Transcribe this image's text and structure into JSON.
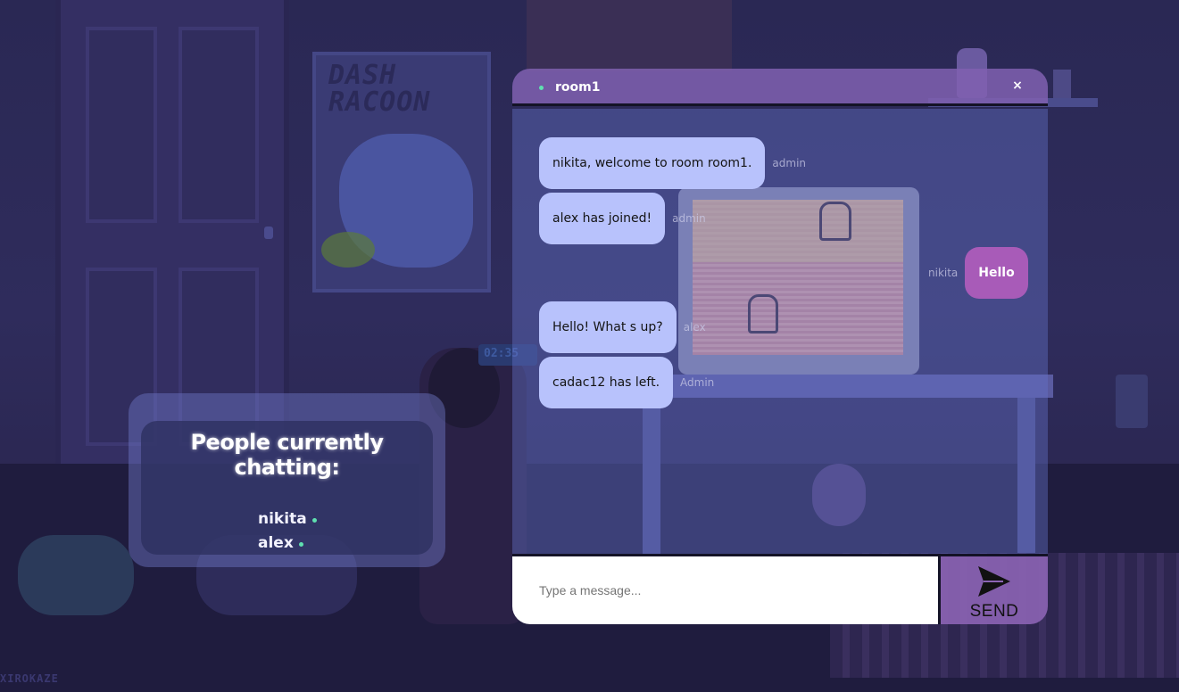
{
  "background": {
    "poster_text": "DASH\nRACOON",
    "clock_text": "02:35",
    "signature": "XIROKAZE"
  },
  "people_panel": {
    "title": "People currently chatting:",
    "users": [
      {
        "name": "nikita",
        "status_color": "#5fe0b0"
      },
      {
        "name": "alex",
        "status_color": "#5fe0b0"
      }
    ]
  },
  "chat": {
    "room_name": "room1",
    "close_label": "×",
    "messages": [
      {
        "text": "nikita, welcome to room room1.",
        "sender": "admin",
        "own": false
      },
      {
        "text": "alex has joined!",
        "sender": "admin",
        "own": false
      },
      {
        "text": "Hello",
        "sender": "nikita",
        "own": true
      },
      {
        "text": "Hello! What s up?",
        "sender": "alex",
        "own": false
      },
      {
        "text": "cadac12 has left.",
        "sender": "Admin",
        "own": false
      }
    ],
    "input_placeholder": "Type a message...",
    "send_label": "SEND",
    "send_icon": "send-arrow-icon"
  },
  "colors": {
    "bubble_other": "#b8c2fc",
    "bubble_own": "#a85bb8",
    "online": "#5fe0b0",
    "header": "#8060b0"
  }
}
